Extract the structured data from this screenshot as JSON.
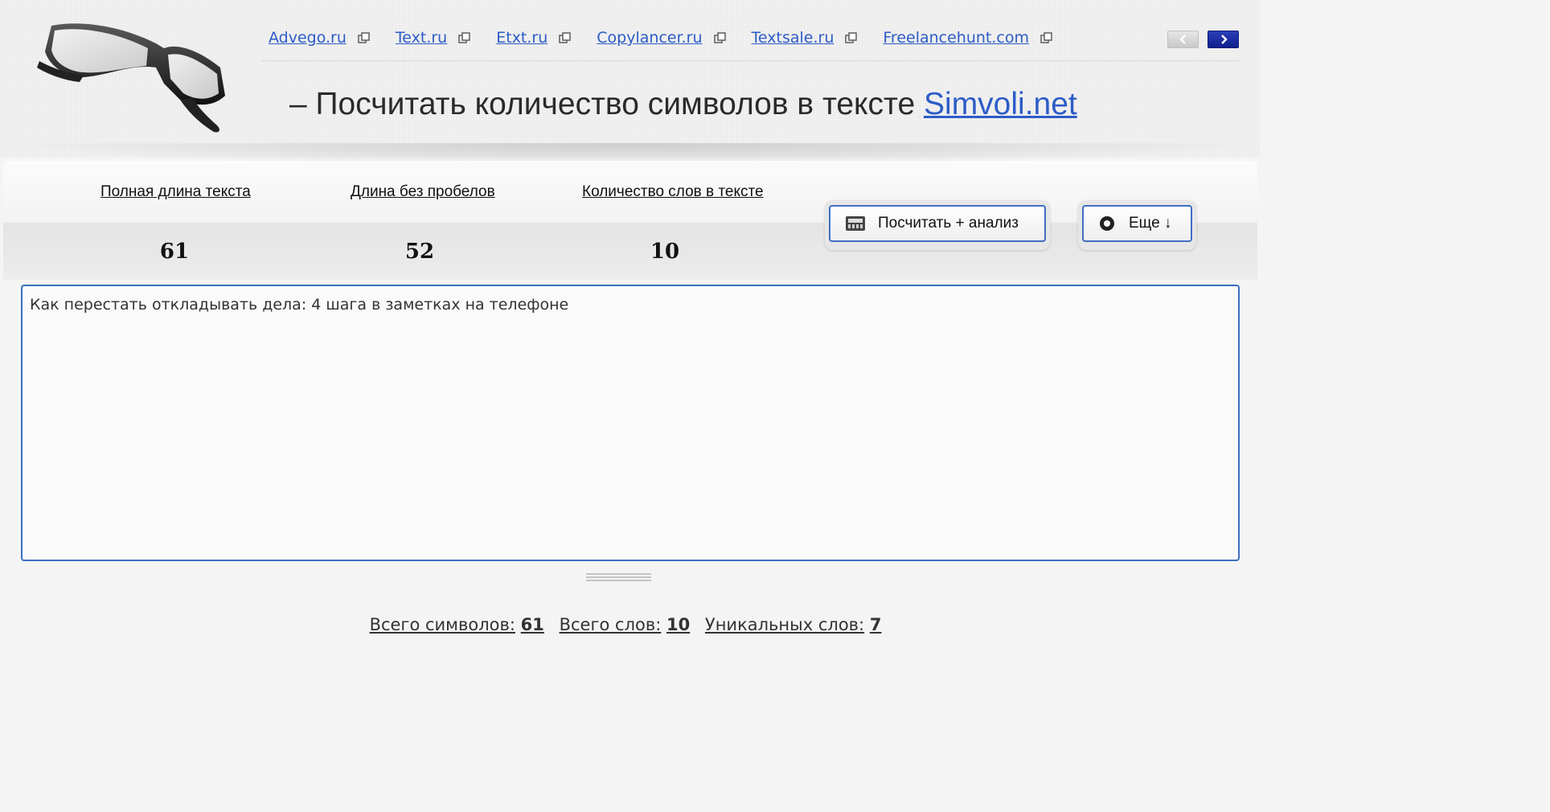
{
  "nav": {
    "links": [
      "Advego.ru",
      "Text.ru",
      "Etxt.ru",
      "Copylancer.ru",
      "Textsale.ru",
      "Freelancehunt.com"
    ]
  },
  "headline": {
    "prefix": "– Посчитать количество символов в тексте",
    "site_link": "Simvoli.net"
  },
  "stats": {
    "full_length_label": "Полная длина текста",
    "full_length_value": "61",
    "no_spaces_label": "Длина без пробелов",
    "no_spaces_value": "52",
    "words_label": "Количество слов в тексте",
    "words_value": "10"
  },
  "buttons": {
    "count_label": "Посчитать + анализ",
    "more_label": "Еще ↓"
  },
  "editor": {
    "text": "Как перестать откладывать дела: 4 шага в заметках на телефоне"
  },
  "summary": {
    "total_chars_label": "Всего символов:",
    "total_chars_value": "61",
    "total_words_label": "Всего слов:",
    "total_words_value": "10",
    "unique_words_label": "Уникальных слов:",
    "unique_words_value": "7"
  },
  "colors": {
    "link": "#2c5cc7",
    "button_border": "#3e6fc2",
    "next_arrow": "#10208c"
  },
  "icons": {
    "logo": "eyeglasses-logo",
    "external": "external-link-icon",
    "prev": "chevron-left-icon",
    "next": "chevron-right-icon",
    "count": "calculator-icon",
    "more": "gear-icon"
  }
}
